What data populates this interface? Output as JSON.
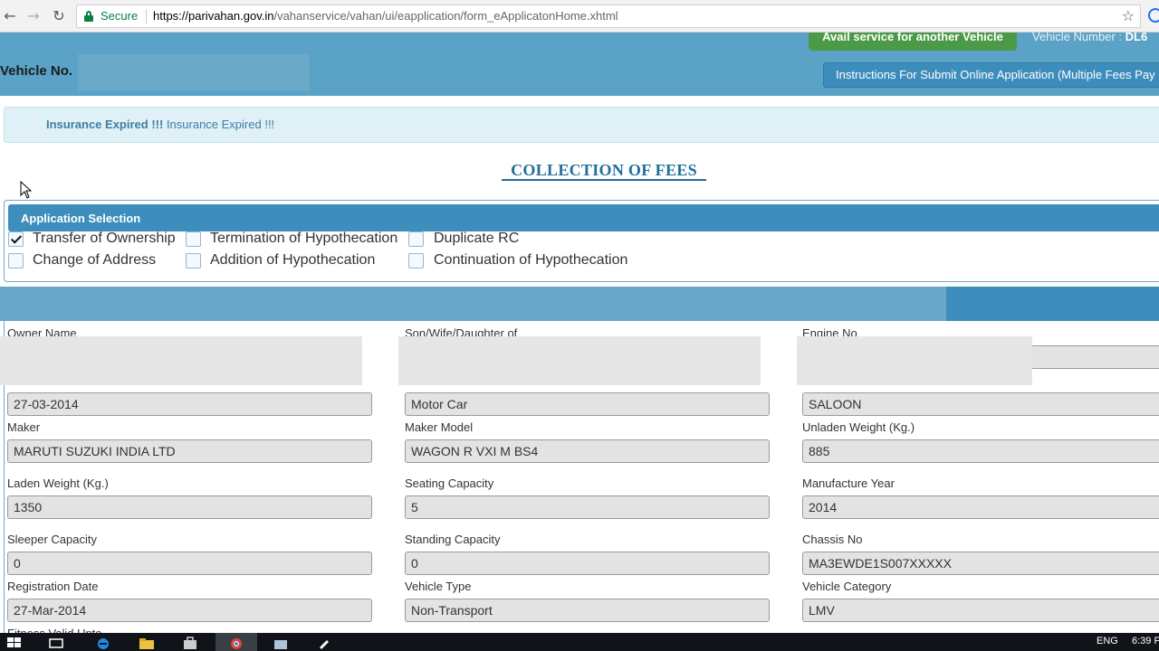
{
  "browser": {
    "secure_label": "Secure",
    "url_host": "https://parivahan.gov.in",
    "url_path": "/vahanservice/vahan/ui/eapplication/form_eApplicatonHome.xhtml"
  },
  "header": {
    "vehicle_no_label": "Vehicle No.",
    "avail_service_button": "Avail service for another Vehicle",
    "vehicle_number_label": "Vehicle Number :",
    "vehicle_number_value": "DL6",
    "instructions_button": "Instructions For Submit Online Application (Multiple Fees Pay"
  },
  "message": {
    "summary": "Insurance Expired !!!",
    "detail": "Insurance Expired !!!"
  },
  "page_title": "COLLECTION OF FEES",
  "application_selection": {
    "heading": "Application Selection",
    "options": [
      {
        "label": "Transfer of Ownership",
        "checked": true
      },
      {
        "label": "Termination of Hypothecation",
        "checked": false
      },
      {
        "label": "Duplicate RC",
        "checked": false
      },
      {
        "label": "Change of Address",
        "checked": false
      },
      {
        "label": "Addition of Hypothecation",
        "checked": false
      },
      {
        "label": "Continuation of Hypothecation",
        "checked": false
      }
    ]
  },
  "details": {
    "owner_name_label": "Owner Name",
    "son_of_label": "Son/Wife/Daughter of",
    "engine_no_label": "Engine No",
    "purchase_date_value": "27-03-2014",
    "vehicle_class_value": "Motor Car",
    "body_type_value": "SALOON",
    "maker_label": "Maker",
    "maker_value": "MARUTI SUZUKI INDIA LTD",
    "maker_model_label": "Maker Model",
    "maker_model_value": "WAGON R VXI M BS4",
    "unladen_weight_label": "Unladen Weight (Kg.)",
    "unladen_weight_value": "885",
    "laden_weight_label": "Laden Weight (Kg.)",
    "laden_weight_value": "1350",
    "seating_capacity_label": "Seating Capacity",
    "seating_capacity_value": "5",
    "manufacture_year_label": "Manufacture Year",
    "manufacture_year_value": "2014",
    "sleeper_capacity_label": "Sleeper Capacity",
    "sleeper_capacity_value": "0",
    "standing_capacity_label": "Standing Capacity",
    "standing_capacity_value": "0",
    "chassis_no_label": "Chassis No",
    "chassis_no_value": "MA3EWDE1S007XXXXX",
    "registration_date_label": "Registration Date",
    "registration_date_value": "27-Mar-2014",
    "vehicle_type_label": "Vehicle Type",
    "vehicle_type_value": "Non-Transport",
    "vehicle_category_label": "Vehicle Category",
    "vehicle_category_value": "LMV",
    "fitness_valid_upto_label": "Fitness Valid Upto"
  },
  "taskbar": {
    "language": "ENG",
    "time": "6:39 F"
  },
  "colors": {
    "header_blue": "#5aa2c6",
    "panel_blue": "#3d8ebc",
    "avail_green": "#4b9a48",
    "secure_green": "#0b8043"
  }
}
